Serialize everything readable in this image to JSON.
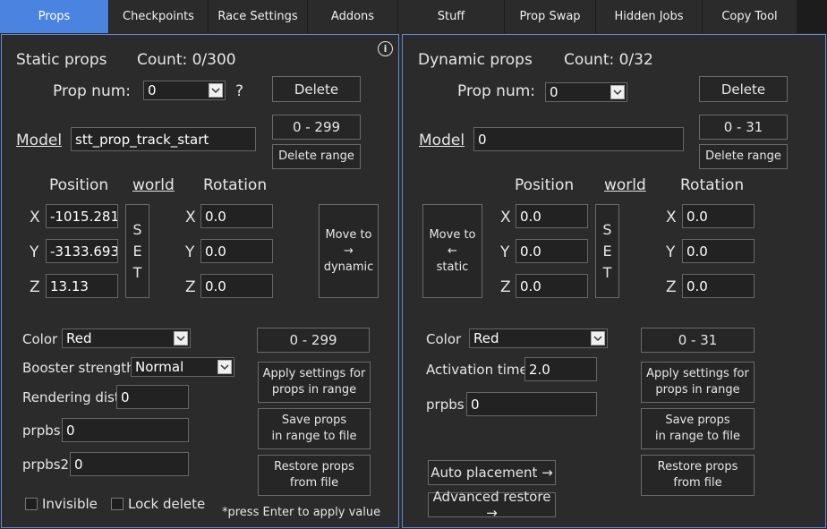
{
  "tabs": [
    "Props",
    "Checkpoints",
    "Race Settings",
    "Addons",
    "Stuff",
    "Prop Swap",
    "Hidden Jobs",
    "Copy Tool"
  ],
  "static": {
    "title": "Static props",
    "count": "Count: 0/300",
    "prop_num_label": "Prop num:",
    "prop_num_value": "0",
    "help": "?",
    "delete": "Delete",
    "range_hint": "0 - 299",
    "model_label": "Model",
    "model_value": "stt_prop_track_start",
    "delete_range": "Delete range",
    "position_label": "Position",
    "world_label": "world",
    "rotation_label": "Rotation",
    "x_label": "X",
    "y_label": "Y",
    "z_label": "Z",
    "pos_x": "-1015.281",
    "pos_y": "-3133.693",
    "pos_z": "13.13",
    "set_letters": [
      "S",
      "E",
      "T"
    ],
    "rot_x": "0.0",
    "rot_y": "0.0",
    "rot_z": "0.0",
    "move_to_dynamic": [
      "Move to",
      "→",
      "dynamic"
    ],
    "color_label": "Color",
    "color_value": "Red",
    "booster_label": "Booster strength",
    "booster_value": "Normal",
    "render_label": "Rendering dist",
    "render_value": "0",
    "prpbs_label": "prpbs",
    "prpbs_value": "0",
    "prpbs2_label": "prpbs2",
    "prpbs2_value": "0",
    "range_box": "0 - 299",
    "apply_settings": [
      "Apply settings for",
      "props in range"
    ],
    "save_props": [
      "Save props",
      "in range to file"
    ],
    "restore_props": [
      "Restore props",
      "from file"
    ],
    "invisible_label": "Invisible",
    "lock_delete_label": "Lock delete",
    "note": "*press Enter to apply value",
    "info_icon": "i"
  },
  "dynamic": {
    "title": "Dynamic props",
    "count": "Count: 0/32",
    "prop_num_label": "Prop num:",
    "prop_num_value": "0",
    "delete": "Delete",
    "range_hint": "0 - 31",
    "model_label": "Model",
    "model_value": "0",
    "delete_range": "Delete range",
    "position_label": "Position",
    "world_label": "world",
    "rotation_label": "Rotation",
    "x_label": "X",
    "y_label": "Y",
    "z_label": "Z",
    "move_to_static": [
      "Move to",
      "←",
      "static"
    ],
    "pos_x": "0.0",
    "pos_y": "0.0",
    "pos_z": "0.0",
    "set_letters": [
      "S",
      "E",
      "T"
    ],
    "rot_x": "0.0",
    "rot_y": "0.0",
    "rot_z": "0.0",
    "color_label": "Color",
    "color_value": "Red",
    "activation_label": "Activation time",
    "activation_value": "2.0",
    "prpbs_label": "prpbs",
    "prpbs_value": "0",
    "range_box": "0 - 31",
    "apply_settings": [
      "Apply settings for",
      "props in range"
    ],
    "save_props": [
      "Save props",
      "in range to file"
    ],
    "restore_props": [
      "Restore props",
      "from file"
    ],
    "auto_placement": "Auto placement →",
    "advanced_restore": "Advanced restore →"
  },
  "colors": {
    "accent": "#4a83e0",
    "panel_border": "#6a86d6",
    "bg": "#2b2b2b"
  },
  "icons": [
    "info-icon",
    "chevron-down-icon"
  ]
}
